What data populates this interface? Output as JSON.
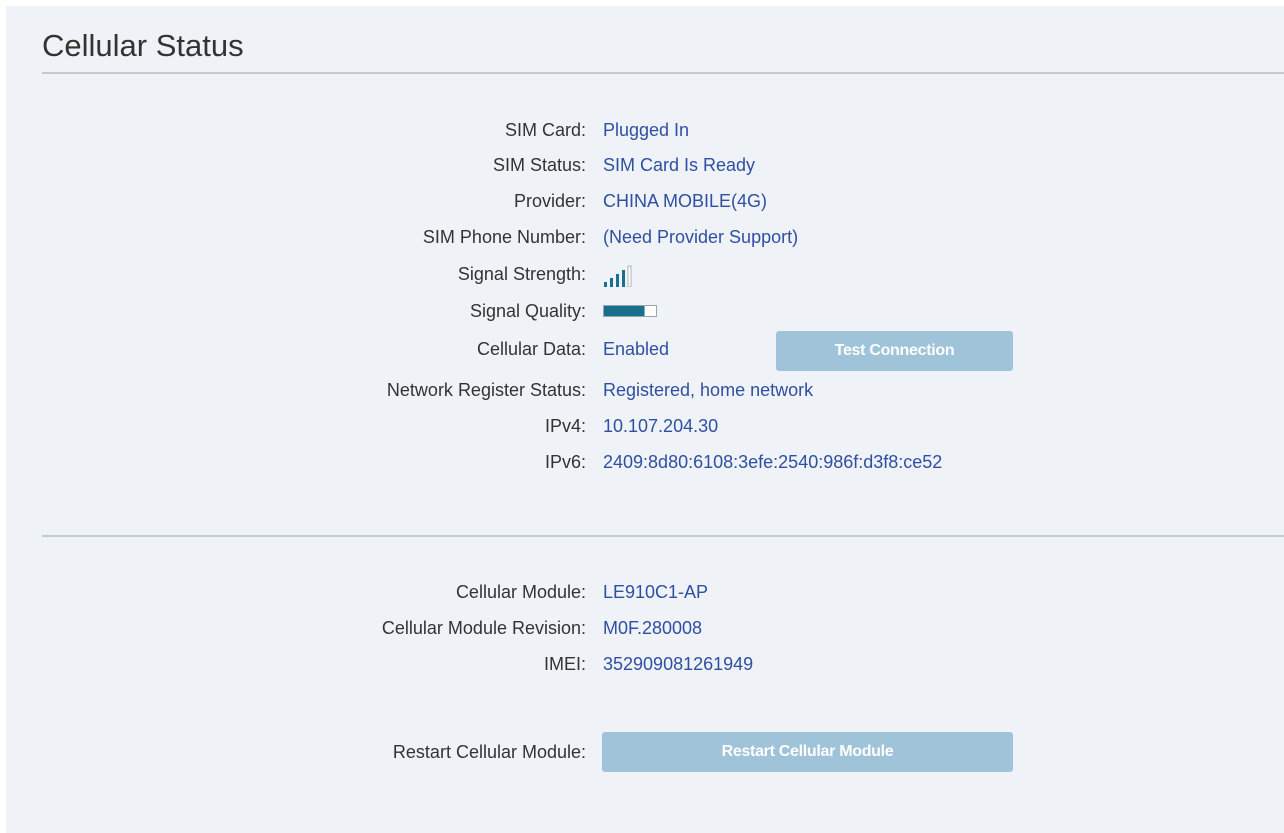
{
  "page": {
    "title": "Cellular Status"
  },
  "status": {
    "sim_card": {
      "label": "SIM Card:",
      "value": "Plugged In"
    },
    "sim_status": {
      "label": "SIM Status:",
      "value": "SIM Card Is Ready"
    },
    "provider": {
      "label": "Provider:",
      "value": "CHINA MOBILE(4G)"
    },
    "sim_phone": {
      "label": "SIM Phone Number:",
      "value": "(Need Provider Support)"
    },
    "signal_strength": {
      "label": "Signal Strength:",
      "bars_filled": 4,
      "bars_total": 5,
      "icon": "signal-bars-icon"
    },
    "signal_quality": {
      "label": "Signal Quality:",
      "level": 0.78,
      "icon": "signal-quality-bar"
    },
    "cellular_data": {
      "label": "Cellular Data:",
      "value": "Enabled"
    },
    "network_register": {
      "label": "Network Register Status:",
      "value": "Registered, home network"
    },
    "ipv4": {
      "label": "IPv4:",
      "value": "10.107.204.30"
    },
    "ipv6": {
      "label": "IPv6:",
      "value": "2409:8d80:6108:3efe:2540:986f:d3f8:ce52"
    }
  },
  "buttons": {
    "test_connection": "Test Connection",
    "restart_module": "Restart Cellular Module"
  },
  "module": {
    "cellular_module": {
      "label": "Cellular Module:",
      "value": "LE910C1-AP"
    },
    "revision": {
      "label": "Cellular Module Revision:",
      "value": "M0F.280008"
    },
    "imei": {
      "label": "IMEI:",
      "value": "352909081261949"
    },
    "restart": {
      "label": "Restart Cellular Module:"
    }
  },
  "colors": {
    "value_text": "#2f4fa2",
    "button_bg": "#9fc3d8",
    "signal": "#1a6f8e",
    "panel_bg": "#eff2f6"
  }
}
